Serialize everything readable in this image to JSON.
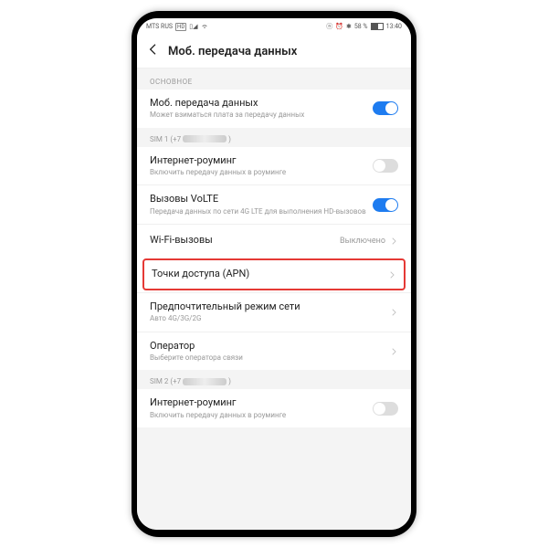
{
  "statusbar": {
    "carrier": "MTS RUS",
    "hd": "HD",
    "battery": "58 %",
    "time": "13:40"
  },
  "header": {
    "title": "Моб. передача данных"
  },
  "sections": {
    "main_label": "ОСНОВНОЕ",
    "mobile_data": {
      "title": "Моб. передача данных",
      "sub": "Может взиматься плата за передачу данных"
    },
    "sim1_label": "SIM 1 (+7",
    "sim1_close": ")",
    "roaming": {
      "title": "Интернет-роуминг",
      "sub": "Включить передачу данных в роуминге"
    },
    "volte": {
      "title": "Вызовы VoLTE",
      "sub": "Передача данных по сети 4G LTE для выполнения HD-вызовов"
    },
    "wifi_calls": {
      "title": "Wi-Fi-вызовы",
      "value": "Выключено"
    },
    "apn": {
      "title": "Точки доступа (APN)"
    },
    "net_mode": {
      "title": "Предпочтительный режим сети",
      "sub": "Авто 4G/3G/2G"
    },
    "operator": {
      "title": "Оператор",
      "sub": "Выберите оператора связи"
    },
    "sim2_label": "SIM 2 (+7",
    "sim2_close": ")",
    "roaming2": {
      "title": "Интернет-роуминг",
      "sub": "Включить передачу данных в роуминге"
    }
  }
}
